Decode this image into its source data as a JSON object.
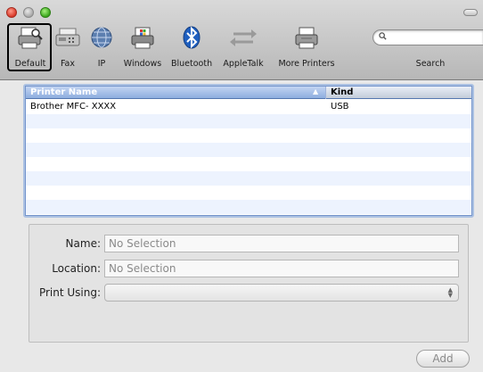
{
  "toolbar": {
    "items": [
      {
        "label": "Default",
        "icon": "printer-default-icon",
        "selected": true
      },
      {
        "label": "Fax",
        "icon": "fax-icon",
        "selected": false
      },
      {
        "label": "IP",
        "icon": "ip-globe-icon",
        "selected": false
      },
      {
        "label": "Windows",
        "icon": "windows-printer-icon",
        "selected": false
      },
      {
        "label": "Bluetooth",
        "icon": "bluetooth-icon",
        "selected": false
      },
      {
        "label": "AppleTalk",
        "icon": "appletalk-arrows-icon",
        "selected": false
      },
      {
        "label": "More Printers",
        "icon": "more-printers-icon",
        "selected": false
      }
    ],
    "search": {
      "placeholder": "",
      "label": "Search"
    }
  },
  "printer_list": {
    "columns": {
      "name": "Printer Name",
      "kind": "Kind"
    },
    "sort_indicator": "▲",
    "rows": [
      {
        "name": "Brother MFC- XXXX",
        "kind": "USB"
      },
      {
        "name": "",
        "kind": ""
      },
      {
        "name": "",
        "kind": ""
      },
      {
        "name": "",
        "kind": ""
      },
      {
        "name": "",
        "kind": ""
      },
      {
        "name": "",
        "kind": ""
      },
      {
        "name": "",
        "kind": ""
      },
      {
        "name": "",
        "kind": ""
      }
    ]
  },
  "details": {
    "name_label": "Name:",
    "name_value": "No Selection",
    "location_label": "Location:",
    "location_value": "No Selection",
    "print_using_label": "Print Using:",
    "print_using_value": ""
  },
  "add_button": "Add",
  "colors": {
    "header_blue": "#6f95d8",
    "row_stripe": "#edf3fe",
    "close_red": "#d93a2a",
    "zoom_green": "#3aa61c"
  }
}
